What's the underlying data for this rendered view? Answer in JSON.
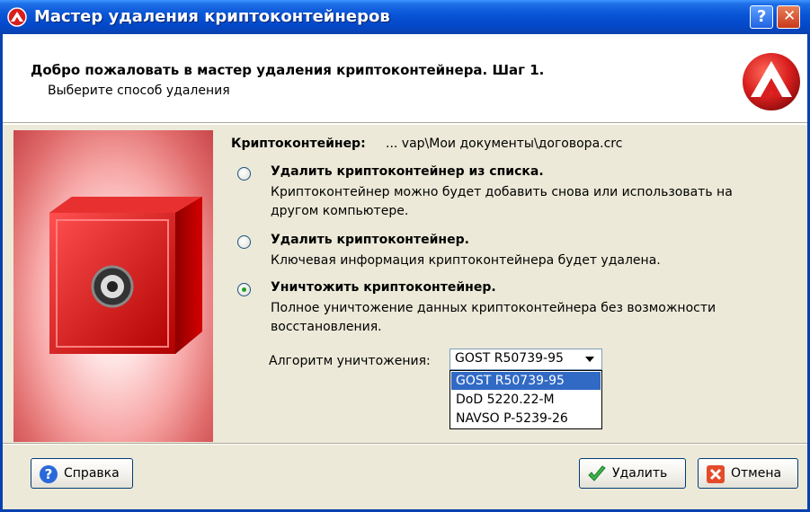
{
  "window": {
    "title": "Мастер удаления криптоконтейнеров",
    "help_glyph": "?",
    "close_glyph": "✕"
  },
  "header": {
    "title": "Добро пожаловать в мастер удаления криптоконтейнера. Шаг 1.",
    "subtitle": "Выберите способ удаления"
  },
  "container": {
    "label": "Криптоконтейнер:",
    "path": "... vap\\Мои документы\\договора.crc"
  },
  "options": [
    {
      "title": "Удалить криптоконтейнер из списка.",
      "desc_line1": "Криптоконтейнер можно будет добавить снова или использовать на",
      "desc_line2": "другом компьютере.",
      "selected": false
    },
    {
      "title": "Удалить криптоконтейнер.",
      "desc_line1": "Ключевая информация криптоконтейнера будет удалена.",
      "selected": false
    },
    {
      "title": "Уничтожить криптоконтейнер.",
      "desc_line1": "Полное уничтожение данных криптоконтейнера без возможности",
      "desc_line2": "восстановления.",
      "selected": true
    }
  ],
  "algorithm": {
    "label": "Алгоритм уничтожения:",
    "selected": "GOST R50739-95",
    "options": [
      "GOST R50739-95",
      "DoD 5220.22-M",
      "NAVSO P-5239-26"
    ]
  },
  "buttons": {
    "help": "Справка",
    "delete": "Удалить",
    "cancel": "Отмена"
  },
  "icons": {
    "help": "help-question-icon",
    "delete": "checkmark-icon",
    "cancel": "red-x-icon",
    "logo": "red-triangle-logo-icon",
    "safe": "red-safe-icon"
  },
  "colors": {
    "titlebar": "#0A56D8",
    "selection": "#316AC5",
    "brand_red": "#D81E1E"
  }
}
